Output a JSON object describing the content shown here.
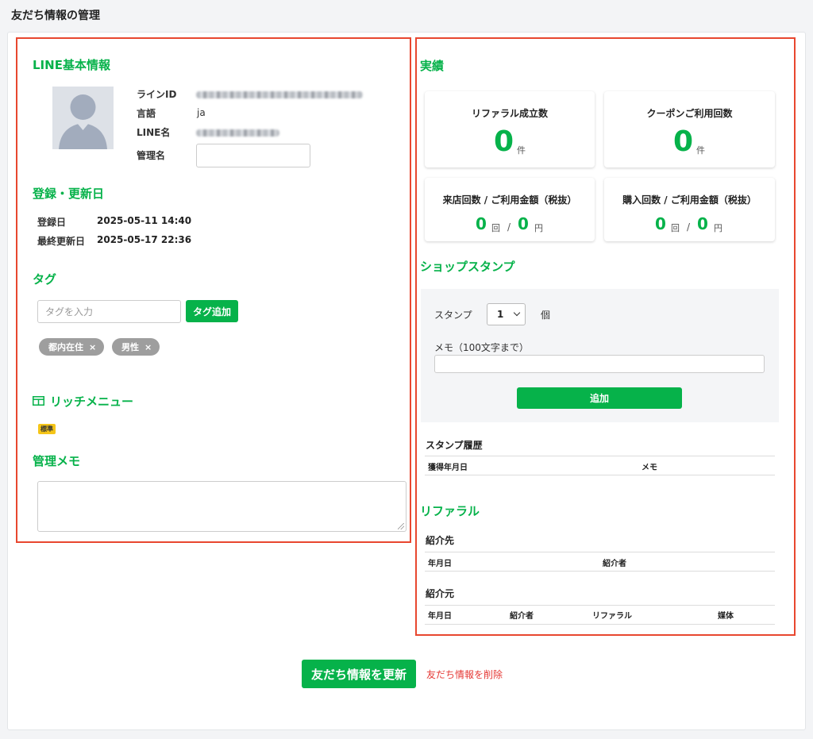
{
  "page_title": "友だち情報の管理",
  "basic_info": {
    "title": "LINE基本情報",
    "line_id_label": "ラインID",
    "language_label": "言語",
    "language_value": "ja",
    "line_name_label": "LINE名",
    "admin_name_label": "管理名",
    "admin_name_value": ""
  },
  "dates": {
    "title": "登録・更新日",
    "registered_label": "登録日",
    "registered_value": "2025-05-11 14:40",
    "updated_label": "最終更新日",
    "updated_value": "2025-05-17 22:36"
  },
  "tags": {
    "title": "タグ",
    "placeholder": "タグを入力",
    "add_button": "タグ追加",
    "items": [
      "都内在住",
      "男性"
    ],
    "remove_glyph": "×"
  },
  "rich_menu": {
    "title": "リッチメニュー",
    "badge": "標準"
  },
  "admin_memo": {
    "title": "管理メモ"
  },
  "results": {
    "title": "実績",
    "referral_label": "リファラル成立数",
    "referral_value": "0",
    "referral_unit": "件",
    "coupon_label": "クーポンご利用回数",
    "coupon_value": "0",
    "coupon_unit": "件",
    "visit_label": "来店回数 / ご利用金額（税抜）",
    "visit_count": "0",
    "visit_count_unit": "回",
    "visit_amount": "0",
    "visit_amount_unit": "円",
    "purchase_label": "購入回数 / ご利用金額（税抜）",
    "purchase_count": "0",
    "purchase_count_unit": "回",
    "purchase_amount": "0",
    "purchase_amount_unit": "円",
    "separator": "/"
  },
  "shop_stamp": {
    "title": "ショップスタンプ",
    "stamp_label": "スタンプ",
    "stamp_value": "1",
    "stamp_unit": "個",
    "memo_label": "メモ（100文字まで）",
    "add_button": "追加",
    "history_title": "スタンプ履歴",
    "col_date": "獲得年月日",
    "col_memo": "メモ"
  },
  "referral": {
    "title": "リファラル",
    "to_title": "紹介先",
    "to_col_date": "年月日",
    "to_col_referrer": "紹介者",
    "from_title": "紹介元",
    "from_col_date": "年月日",
    "from_col_referrer": "紹介者",
    "from_col_referral": "リファラル",
    "from_col_media": "媒体"
  },
  "actions": {
    "update_button": "友だち情報を更新",
    "delete_link": "友だち情報を削除"
  },
  "colors": {
    "accent": "#06b24a",
    "highlight_border": "#e8472f",
    "delete": "#e53935"
  }
}
